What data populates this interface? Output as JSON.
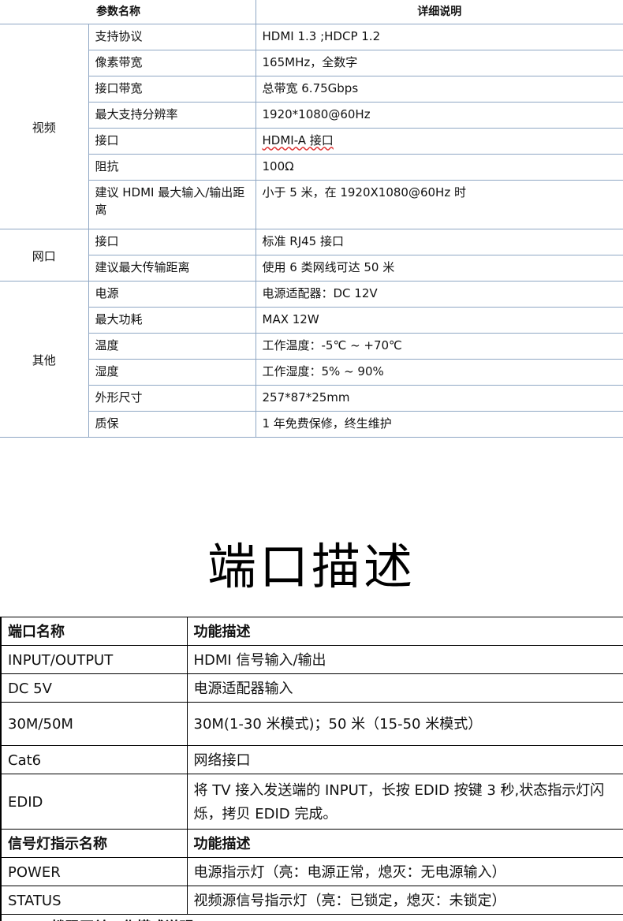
{
  "spec_table": {
    "headers": [
      "参数名称",
      "详细说明"
    ],
    "groups": [
      {
        "category": "视频",
        "rows": [
          {
            "param": "支持协议",
            "detail": "HDMI 1.3 ;HDCP 1.2"
          },
          {
            "param": "像素带宽",
            "detail": "165MHz，全数字"
          },
          {
            "param": "接口带宽",
            "detail": "总带宽 6.75Gbps"
          },
          {
            "param": "最大支持分辨率",
            "detail": "1920*1080@60Hz"
          },
          {
            "param": "接口",
            "detail": "HDMI-A 接口"
          },
          {
            "param": "阻抗",
            "detail": "100Ω"
          },
          {
            "param": "建议 HDMI 最大输入/输出距离",
            "detail": "小于 5 米，在 1920X1080@60Hz 时"
          }
        ]
      },
      {
        "category": "网口",
        "rows": [
          {
            "param": "接口",
            "detail": "标准 RJ45 接口"
          },
          {
            "param": "建议最大传输距离",
            "detail": "使用 6 类网线可达 50 米"
          }
        ]
      },
      {
        "category": "其他",
        "rows": [
          {
            "param": "电源",
            "detail": "电源适配器：DC 12V"
          },
          {
            "param": "最大功耗",
            "detail": "MAX 12W"
          },
          {
            "param": "温度",
            "detail": "工作温度：-5℃ ~ +70℃"
          },
          {
            "param": "湿度",
            "detail": "工作湿度：5% ~ 90%"
          },
          {
            "param": "外形尺寸",
            "detail": "257*87*25mm"
          },
          {
            "param": "质保",
            "detail": "1 年免费保修，终生维护"
          }
        ]
      }
    ]
  },
  "section_title": "端口描述",
  "port_table": {
    "rows": [
      {
        "name": "端口名称",
        "desc": "功能描述"
      },
      {
        "name": "INPUT/OUTPUT",
        "desc": "HDMI 信号输入/输出"
      },
      {
        "name": "DC 5V",
        "desc": "电源适配器输入"
      },
      {
        "name": "30M/50M",
        "desc": "30M(1-30 米模式)；50 米（15-50 米模式）"
      },
      {
        "name": "Cat6",
        "desc": "网络接口"
      },
      {
        "name": "EDID",
        "desc": "将 TV 接入发送端的 INPUT，长按 EDID 按键 3 秒,状态指示灯闪烁，拷贝 EDID 完成。"
      },
      {
        "name": "信号灯指示名称",
        "desc": "功能描述"
      },
      {
        "name": "POWER",
        "desc": "电源指示灯（亮：电源正常，熄灭：无电源输入）"
      },
      {
        "name": "STATUS",
        "desc": "视频源信号指示灯（亮：已锁定，熄灭：未锁定）"
      }
    ],
    "footer_partial": "EDID 拨码开关工作模式说明"
  }
}
